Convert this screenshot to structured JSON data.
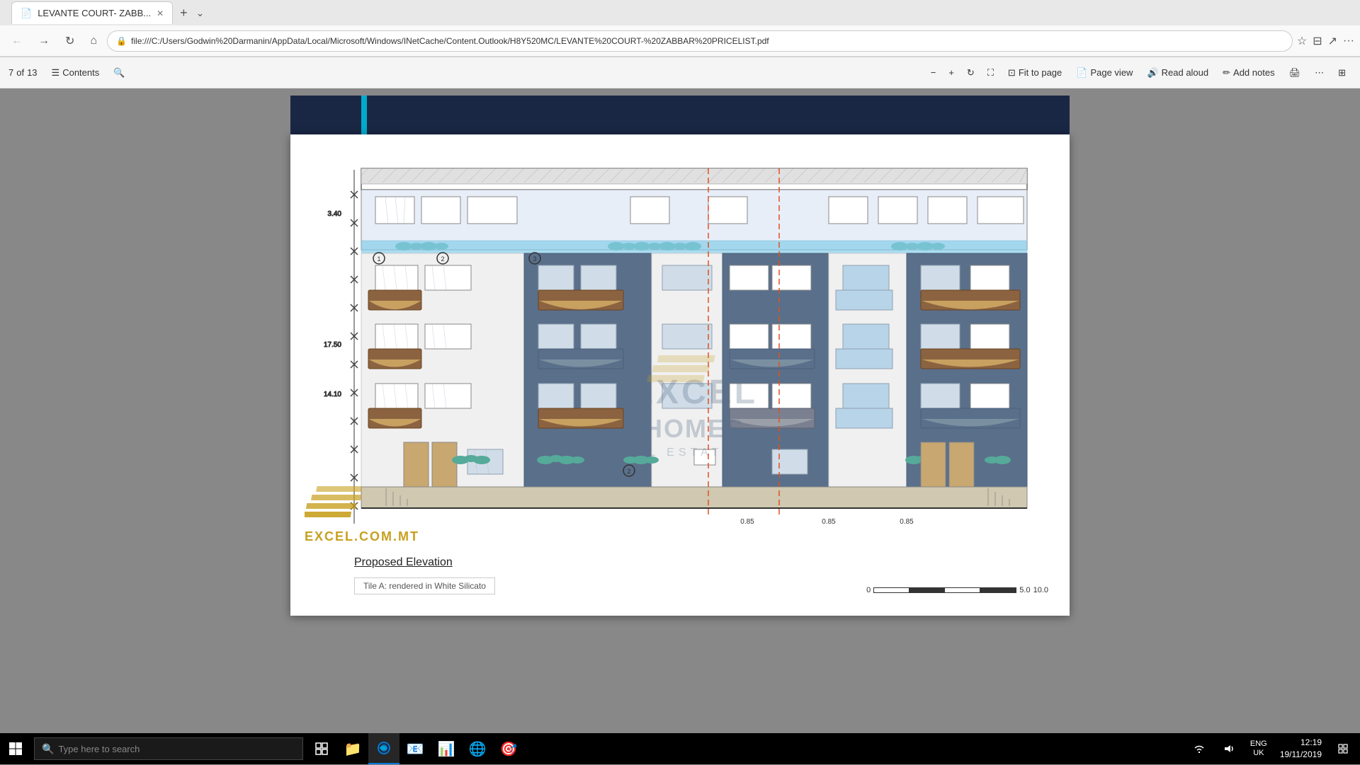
{
  "browser": {
    "tab_title": "LEVANTE COURT- ZABB...",
    "tab_icon": "📄",
    "address": "file:///C:/Users/Godwin%20Darmanin/AppData/Local/Microsoft/Windows/INetCache/Content.Outlook/H8Y520MC/LEVANTE%20COURT-%20ZABBAR%20PRICELIST.pdf",
    "back_btn": "←",
    "forward_btn": "→",
    "refresh_btn": "↻",
    "home_btn": "⌂"
  },
  "pdf_toolbar": {
    "page_current": "7",
    "page_total": "13",
    "contents_label": "Contents",
    "zoom_out": "−",
    "zoom_in": "+",
    "fit_to_page": "Fit to page",
    "page_view": "Page view",
    "read_aloud": "Read aloud",
    "add_notes": "Add notes",
    "print_icon": "🖨",
    "of_label": "of"
  },
  "elevation": {
    "title": "Proposed Elevation",
    "material_note": "Tile A: rendered in White Silicato",
    "measurements": {
      "height1": "3.40",
      "height2": "17.50",
      "height3": "14.10",
      "width1": "0.85",
      "width2": "0.85",
      "width3": "0.85",
      "scale_0": "0",
      "scale_5": "5.0",
      "scale_10": "10.0"
    }
  },
  "logo": {
    "company": "EXCEL.COM.MT",
    "brand": "EXCEL HOMES",
    "tagline": "REAL ESTATE LTD"
  },
  "taskbar": {
    "search_placeholder": "Type here to search",
    "start_icon": "⊞",
    "clock_time": "12:19",
    "clock_date": "19/11/2019",
    "language": "ENG",
    "region": "UK",
    "app_icons": [
      "📁",
      "📧",
      "📊",
      "🌐",
      "🎯"
    ]
  }
}
